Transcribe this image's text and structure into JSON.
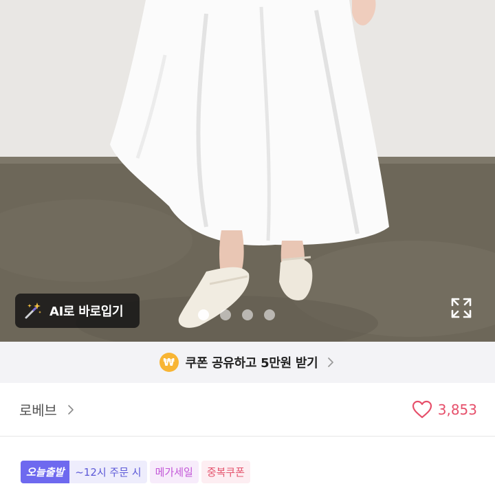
{
  "product_image": {
    "ai_tryon_label": "AI로 바로입기",
    "total_images": 4,
    "active_image_index": 0
  },
  "coupon_banner": {
    "icon_symbol": "₩",
    "text": "쿠폰 공유하고 5만원 받기"
  },
  "brand": {
    "name": "로베브"
  },
  "likes": {
    "count": "3,853"
  },
  "badges": {
    "today_delivery": "오늘출발",
    "cutoff": "~12시 주문 시",
    "mega_sale": "메가세일",
    "double_coupon": "중복쿠폰"
  },
  "colors": {
    "heart": "#e64f6a",
    "coin": "#f8b534",
    "today_badge": "#6e69ef",
    "mega_badge_text": "#c255d7",
    "coupon_badge_text": "#e5566f"
  }
}
